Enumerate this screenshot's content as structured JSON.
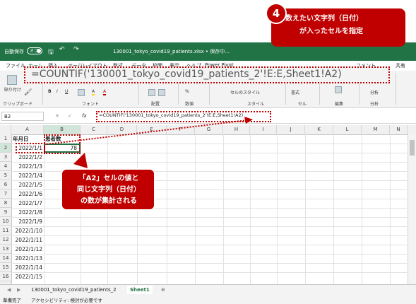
{
  "titlebar": {
    "autosave_label": "自動保存",
    "autosave_state": "オフ",
    "filename": "130001_tokyo_covid19_patients.xlsx • 保存中..."
  },
  "tabs": [
    "ファイル",
    "ホーム",
    "挿入",
    "ページレイアウト",
    "数式",
    "データ",
    "校閲",
    "表示",
    "ヘルプ",
    "Power Pivot"
  ],
  "comment_button": "コメント",
  "share_button": "共有",
  "ribbon": {
    "paste": "貼り付け",
    "clipboard": "クリップボード",
    "font": "フォント",
    "alignment": "配置",
    "number": "数値",
    "cell_style": "セルのスタイル",
    "style": "スタイル",
    "format": "書式",
    "cells": "セル",
    "edit": "編集",
    "analysis": "分析"
  },
  "zoomed_formula": "=COUNTIF('130001_tokyo_covid19_patients_2'!E:E,Sheet1!A2)",
  "formula_bar": {
    "name_box": "B2",
    "fx": "fx",
    "formula": "=COUNTIF('130001_tokyo_covid19_patients_2'!E:E,Sheet1!A2)"
  },
  "columns": [
    "A",
    "B",
    "C",
    "D",
    "E",
    "F",
    "G",
    "H",
    "I",
    "J",
    "K",
    "L",
    "M",
    "N"
  ],
  "rows": [
    "1",
    "2",
    "3",
    "4",
    "5",
    "6",
    "7",
    "8",
    "9",
    "10",
    "11",
    "12",
    "13",
    "14",
    "15",
    "16"
  ],
  "headers": {
    "a1": "年月日",
    "b1": "患者数"
  },
  "dates": [
    "2022/1/1",
    "2022/1/2",
    "2022/1/3",
    "2022/1/4",
    "2022/1/5",
    "2022/1/6",
    "2022/1/7",
    "2022/1/8",
    "2022/1/9",
    "2022/1/10",
    "2022/1/11",
    "2022/1/12",
    "2022/1/13",
    "2022/1/14",
    "2022/1/15"
  ],
  "b2_value": "78",
  "sheets": [
    "130001_tokyo_covid19_patients_2",
    "Sheet1"
  ],
  "status": {
    "ready": "準備完了",
    "accessibility": "アクセシビリティ: 検討が必要です"
  },
  "callout_top": {
    "number": "4",
    "line1": "数えたい文字列（日付）",
    "line2": "が入ったセルを指定"
  },
  "callout_mid": {
    "line1": "「A2」セルの値と",
    "line2": "同じ文字列（日付）",
    "line3": "の数が集計される"
  },
  "colors": {
    "excel_green": "#217346",
    "callout_red": "#c00000"
  }
}
